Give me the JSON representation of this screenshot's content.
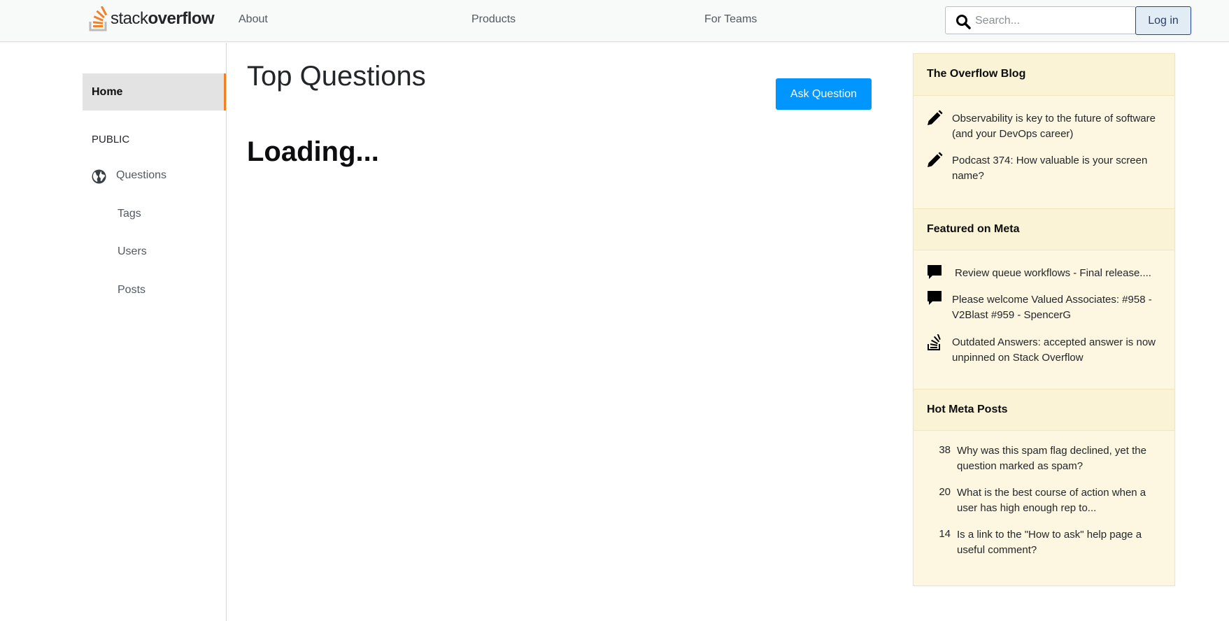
{
  "header": {
    "logo_text_light": "stack",
    "logo_text_bold": "overflow",
    "nav": [
      "About",
      "Products",
      "For Teams"
    ],
    "search_placeholder": "Search...",
    "login_label": "Log in"
  },
  "sidebar": {
    "home": "Home",
    "section": "PUBLIC",
    "items": [
      "Questions",
      "Tags",
      "Users",
      "Posts"
    ]
  },
  "main": {
    "title": "Top Questions",
    "ask_button": "Ask Question",
    "status": "Loading..."
  },
  "widget": {
    "blog_title": "The Overflow Blog",
    "blog_items": [
      "Observability is key to the future of software (and your DevOps career)",
      "Podcast 374: How valuable is your screen name?"
    ],
    "meta_title": "Featured on Meta",
    "meta_items": [
      "Review queue workflows - Final release....",
      "Please welcome Valued Associates: #958 - V2Blast #959 - SpencerG",
      "Outdated Answers: accepted answer is now unpinned on Stack Overflow"
    ],
    "hot_title": "Hot Meta Posts",
    "hot_items": [
      {
        "score": "38",
        "text": "Why was this spam flag declined, yet the question marked as spam?"
      },
      {
        "score": "20",
        "text": "What is the best course of action when a user has high enough rep to..."
      },
      {
        "score": "14",
        "text": "Is a link to the \"How to ask\" help page a useful comment?"
      }
    ]
  },
  "icons": {
    "logo": "stackoverflow-logo",
    "search": "search-icon",
    "globe": "globe-icon",
    "pencil": "pencil-icon",
    "comment": "comment-icon",
    "stackoverflow": "stackoverflow-icon"
  },
  "colors": {
    "accent_orange": "#f48024",
    "ask_button": "#0095ff",
    "widget_bg": "#fdf7e2"
  }
}
